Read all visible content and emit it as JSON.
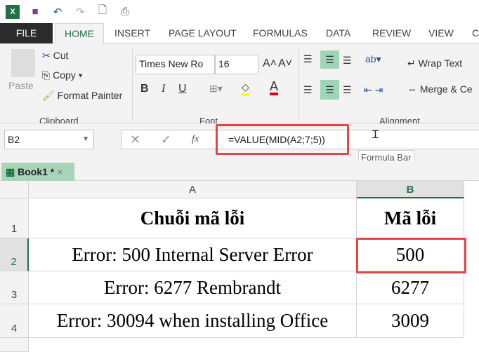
{
  "qat": {
    "icons": [
      "excel-logo-icon",
      "save-icon",
      "undo-icon",
      "redo-icon",
      "print-preview-icon",
      "touch-mode-icon"
    ]
  },
  "tabs": [
    "FILE",
    "HOME",
    "INSERT",
    "PAGE LAYOUT",
    "FORMULAS",
    "DATA",
    "REVIEW",
    "VIEW",
    "C"
  ],
  "clipboard": {
    "paste": "Paste",
    "cut": "Cut",
    "copy": "Copy",
    "format_painter": "Format Painter",
    "group": "Clipboard"
  },
  "font": {
    "name": "Times New Ro",
    "size": "16",
    "bold": "B",
    "italic": "I",
    "underline": "U",
    "font_color": "A",
    "group": "Font"
  },
  "alignment": {
    "wrap": "Wrap Text",
    "merge": "Merge & Ce",
    "group": "Alignment"
  },
  "formula_bar": {
    "name_box": "B2",
    "formula": "=VALUE(MID(A2;7;5))",
    "tooltip": "Formula Bar",
    "fx": "fx"
  },
  "workbook_tab": {
    "label": "Book1 *"
  },
  "colors": {
    "accent": "#217346",
    "highlight": "#e04848"
  },
  "sheet": {
    "columns": [
      "A",
      "B"
    ],
    "rows": [
      {
        "num": "1",
        "a": "Chuỗi mã lỗi",
        "b": "Mã lỗi"
      },
      {
        "num": "2",
        "a": "Error: 500 Internal Server Error",
        "b": "500"
      },
      {
        "num": "3",
        "a": "Error: 6277 Rembrandt",
        "b": "6277"
      },
      {
        "num": "4",
        "a": "Error: 30094 when installing Office",
        "b": "3009"
      }
    ]
  }
}
